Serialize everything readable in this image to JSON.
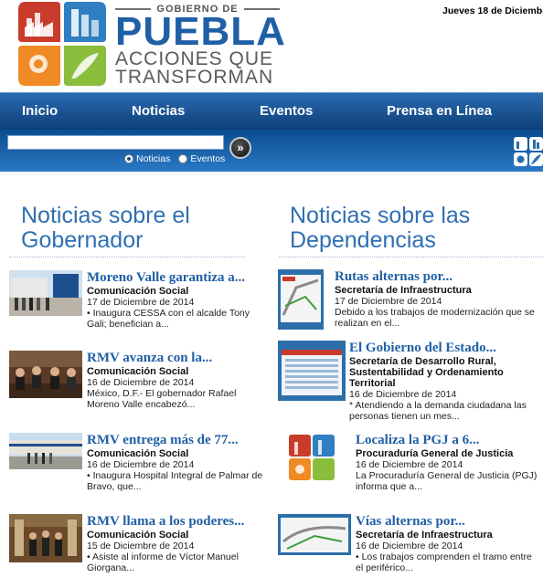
{
  "header": {
    "gobierno": "GOBIERNO DE",
    "puebla": "PUEBLA",
    "line1": "ACCIONES QUE",
    "line2": "TRANSFORMAN",
    "date": "Jueves 18 de Diciembr"
  },
  "nav": {
    "items": [
      "Inicio",
      "Noticias",
      "Eventos",
      "Prensa en Línea"
    ]
  },
  "search": {
    "value": "",
    "go_label": "»",
    "options": [
      "Noticias",
      "Eventos"
    ],
    "selected": "Noticias"
  },
  "colors": {
    "brand_blue": "#1f5fa5",
    "nav_dark": "#0d3f78",
    "section_title": "#2f6fb3"
  },
  "left": {
    "title_line1": "Noticias sobre el",
    "title_line2": "Gobernador",
    "items": [
      {
        "title": "Moreno Valle garantiza a...",
        "source": "Comunicación Social",
        "date": "17 de Diciembre de 2014",
        "desc1": "• Inaugura CESSA con el alcalde Tony",
        "desc2": "Gali; benefician a..."
      },
      {
        "title": "RMV avanza con la...",
        "source": "Comunicación Social",
        "date": "16 de Diciembre de 2014",
        "desc1": "México, D.F.- El gobernador Rafael",
        "desc2": "Moreno Valle encabezó..."
      },
      {
        "title": "RMV entrega más de 77...",
        "source": "Comunicación Social",
        "date": "16 de Diciembre de 2014",
        "desc1": "• Inaugura Hospital Integral de Palmar de",
        "desc2": "Bravo, que..."
      },
      {
        "title": "RMV llama a los poderes...",
        "source": "Comunicación Social",
        "date": "15 de Diciembre de 2014",
        "desc1": "• Asiste al informe de Víctor Manuel",
        "desc2": "Giorgana..."
      }
    ]
  },
  "right": {
    "title_line1": "Noticias sobre las",
    "title_line2": "Dependencias",
    "items": [
      {
        "title": "Rutas alternas por...",
        "source1": "Secretaría de Infraestructura",
        "source2": "",
        "source3": "",
        "date": "17 de Diciembre de 2014",
        "desc1": "Debido a los trabajos de modernización que se",
        "desc2": "realizan en el..."
      },
      {
        "title": "El Gobierno del Estado...",
        "source1": "Secretaría de Desarrollo Rural,",
        "source2": "Sustentabilidad y Ordenamiento",
        "source3": "Territorial",
        "date": "16 de Diciembre de 2014",
        "desc1": "* Atendiendo a la demanda ciudadana las",
        "desc2": "personas tienen un mes..."
      },
      {
        "title": "Localiza la PGJ a 6...",
        "source1": "Procuraduría General de Justicia",
        "source2": "",
        "source3": "",
        "date": "16 de Diciembre de 2014",
        "desc1": "La Procuraduría General de Justicia (PGJ)",
        "desc2": "informa que  a..."
      },
      {
        "title": "Vías alternas por...",
        "source1": "Secretaría de Infraestructura",
        "source2": "",
        "source3": "",
        "date": "16 de Diciembre de 2014",
        "desc1": "• Los trabajos comprenden el tramo entre",
        "desc2": "el periférico..."
      }
    ]
  }
}
